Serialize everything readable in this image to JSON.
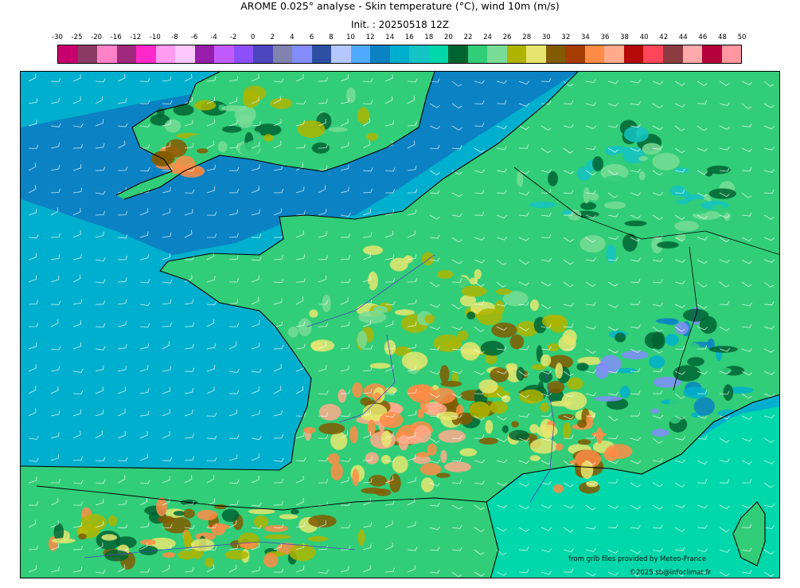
{
  "header": {
    "title": "AROME 0.025° analyse - Skin temperature (°C), wind 10m (m/s)",
    "init": "Init. : 20250518 12Z"
  },
  "legend": {
    "ticks": [
      "-30",
      "-25",
      "-20",
      "-16",
      "-12",
      "-10",
      "-8",
      "-6",
      "-4",
      "-2",
      "0",
      "2",
      "4",
      "6",
      "8",
      "10",
      "12",
      "14",
      "16",
      "18",
      "20",
      "22",
      "24",
      "26",
      "28",
      "30",
      "32",
      "34",
      "36",
      "38",
      "40",
      "42",
      "44",
      "46",
      "48",
      "50"
    ],
    "colors": [
      "#c8006e",
      "#8c3c64",
      "#ff82c8",
      "#a0287d",
      "#ff28c8",
      "#ff9bf0",
      "#ffc8ff",
      "#961eaa",
      "#c35aff",
      "#8c50fa",
      "#4b46be",
      "#8282af",
      "#828cfa",
      "#2d50a5",
      "#b4c8ff",
      "#50aaff",
      "#0a82c3",
      "#00afcd",
      "#14c3c3",
      "#00d7aa",
      "#006432",
      "#32cd78",
      "#78dc96",
      "#afb400",
      "#e6e66e",
      "#825a00",
      "#a53c00",
      "#ff8c46",
      "#ffaa8c",
      "#b40a0a",
      "#ff465a",
      "#8c3c41",
      "#ffaaaa",
      "#b4003c",
      "#ff96a0"
    ]
  },
  "map": {
    "sea_color": "#00afcd",
    "channel_color": "#0a82c3",
    "med_color": "#00d7aa",
    "land_base_color": "#32cd78",
    "wind_barb_color": "#ffffff",
    "coast_color": "#000000",
    "river_color": "#4b46be"
  },
  "credits": {
    "source": "from grib files provided by Meteo-France",
    "copyright": "©2025 sb@infoclimat.fr"
  }
}
